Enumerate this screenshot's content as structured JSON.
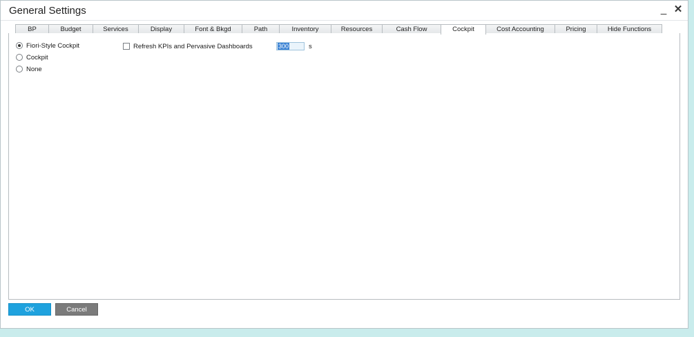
{
  "window": {
    "title": "General Settings",
    "minimize_symbol": "_",
    "close_symbol": "✕"
  },
  "tabs": [
    {
      "label": "BP",
      "active": false
    },
    {
      "label": "Budget",
      "active": false
    },
    {
      "label": "Services",
      "active": false
    },
    {
      "label": "Display",
      "active": false
    },
    {
      "label": "Font & Bkgd",
      "active": false
    },
    {
      "label": "Path",
      "active": false
    },
    {
      "label": "Inventory",
      "active": false
    },
    {
      "label": "Resources",
      "active": false
    },
    {
      "label": "Cash Flow",
      "active": false
    },
    {
      "label": "Cockpit",
      "active": true
    },
    {
      "label": "Cost Accounting",
      "active": false
    },
    {
      "label": "Pricing",
      "active": false
    },
    {
      "label": "Hide Functions",
      "active": false
    }
  ],
  "cockpit": {
    "options": [
      {
        "label": "Fiori-Style Cockpit",
        "selected": true
      },
      {
        "label": "Cockpit",
        "selected": false
      },
      {
        "label": "None",
        "selected": false
      }
    ],
    "refresh_label": "Refresh KPIs and Pervasive Dashboards",
    "refresh_checked": false,
    "refresh_value": "300",
    "refresh_unit": "s"
  },
  "footer": {
    "ok_label": "OK",
    "cancel_label": "Cancel"
  },
  "colors": {
    "ok_button": "#1fa2de",
    "cancel_button": "#7b7b7b",
    "background": "#c9ecec"
  }
}
